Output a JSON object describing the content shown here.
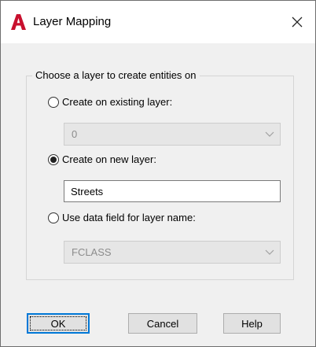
{
  "window": {
    "title": "Layer Mapping",
    "app_icon": "autocad-a-icon",
    "close_icon": "close-icon"
  },
  "group": {
    "legend": "Choose a layer to create entities on",
    "options": [
      {
        "label": "Create on existing layer:",
        "selected": false
      },
      {
        "label": "Create on new layer:",
        "selected": true
      },
      {
        "label": "Use data field for layer name:",
        "selected": false
      }
    ],
    "existing_layer_value": "0",
    "new_layer_value": "Streets",
    "data_field_value": "FCLASS"
  },
  "buttons": {
    "ok": "OK",
    "cancel": "Cancel",
    "help": "Help"
  },
  "colors": {
    "accent": "#0078d7",
    "app_icon_red": "#c8102e"
  }
}
